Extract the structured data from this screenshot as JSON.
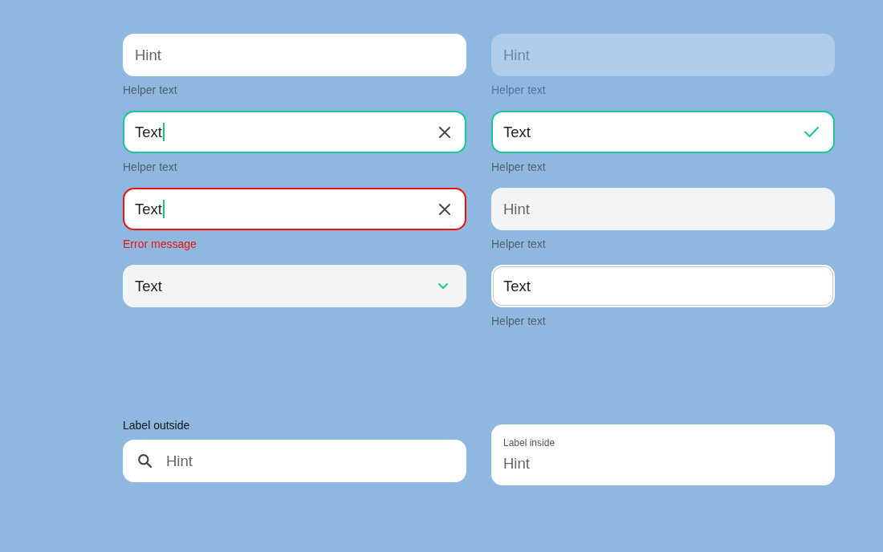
{
  "columns": [
    {
      "fields": [
        {
          "kind": "text",
          "focused": false,
          "error": false,
          "valid": false,
          "disabled": false,
          "hovered": false,
          "outlined": false,
          "placeholder": "Hint",
          "helper": "Helper text"
        },
        {
          "kind": "text",
          "focused": true,
          "error": false,
          "valid": false,
          "disabled": false,
          "hovered": false,
          "outlined": false,
          "value": "Text",
          "helper": "Helper text"
        },
        {
          "kind": "text",
          "focused": true,
          "error": true,
          "valid": false,
          "disabled": false,
          "hovered": false,
          "outlined": false,
          "value": "Text",
          "helper": "Error message"
        },
        {
          "kind": "select",
          "focused": false,
          "error": false,
          "valid": false,
          "disabled": false,
          "hovered": true,
          "outlined": false,
          "value": "Text"
        }
      ]
    },
    {
      "fields": [
        {
          "kind": "text",
          "focused": false,
          "error": false,
          "valid": false,
          "disabled": true,
          "hovered": false,
          "outlined": false,
          "placeholder": "Hint",
          "helper": "Helper text"
        },
        {
          "kind": "text",
          "focused": false,
          "error": false,
          "valid": true,
          "disabled": false,
          "hovered": false,
          "outlined": false,
          "value": "Text",
          "helper": "Helper text"
        },
        {
          "kind": "text",
          "focused": false,
          "error": false,
          "valid": false,
          "disabled": false,
          "hovered": true,
          "outlined": false,
          "placeholder": "Hint",
          "helper": "Helper text"
        },
        {
          "kind": "text",
          "focused": false,
          "error": false,
          "valid": false,
          "disabled": false,
          "hovered": false,
          "outlined": true,
          "value": "Text",
          "helper": "Helper text"
        }
      ]
    }
  ],
  "labeled_fields": [
    {
      "kind": "search",
      "label": "Label outside",
      "placeholder": "Hint"
    },
    {
      "kind": "inner_label",
      "label": "Label inside",
      "placeholder": "Hint"
    }
  ]
}
